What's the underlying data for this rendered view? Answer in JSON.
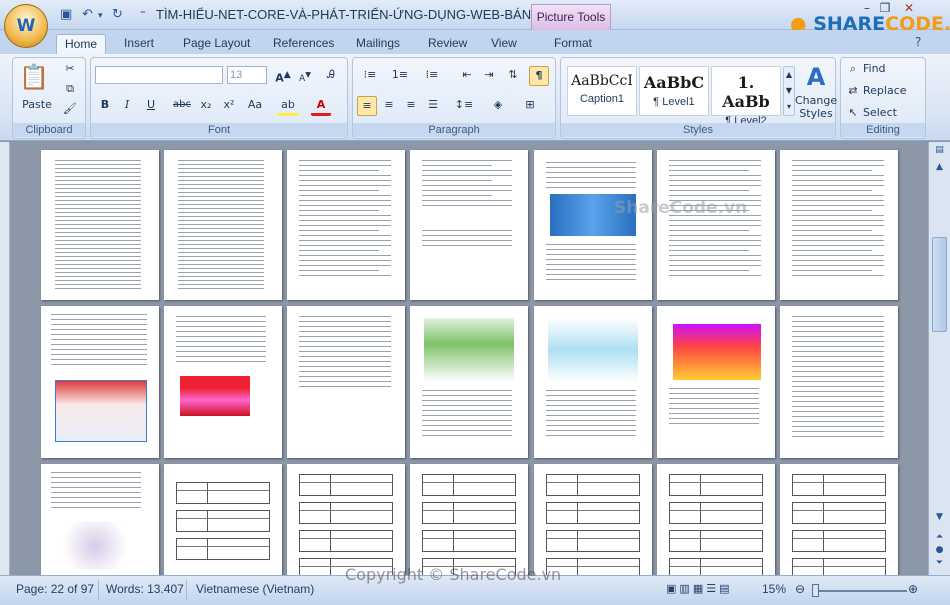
{
  "titlebar": {
    "title": "TÌM-HIỂU-NET-CORE-VÀ-PHÁT-TRIỂN-ỨNG-DỤNG-WEB-BÁN-H...",
    "contextual_tab": "Picture Tools",
    "brand_prefix": "SHARE",
    "brand_suffix": "CODE.vn",
    "office_button_glyph": "W"
  },
  "tabs": [
    {
      "label": "Home",
      "active": true
    },
    {
      "label": "Insert"
    },
    {
      "label": "Page Layout"
    },
    {
      "label": "References"
    },
    {
      "label": "Mailings"
    },
    {
      "label": "Review"
    },
    {
      "label": "View"
    },
    {
      "label": "Format"
    }
  ],
  "ribbon": {
    "clipboard": {
      "label": "Clipboard",
      "paste": "Paste"
    },
    "font": {
      "label": "Font",
      "font_name": "",
      "font_size": "13"
    },
    "paragraph": {
      "label": "Paragraph"
    },
    "styles": {
      "label": "Styles",
      "items": [
        {
          "sample": "AaBbCcI",
          "name": "Caption1"
        },
        {
          "sample": "AaBbC",
          "name": "¶ Level1"
        },
        {
          "sample": "1. AaBb",
          "name": "¶ Level2"
        }
      ],
      "change_styles": "Change Styles"
    },
    "editing": {
      "label": "Editing",
      "find": "Find",
      "replace": "Replace",
      "select": "Select"
    }
  },
  "statusbar": {
    "page": "Page: 22 of 97",
    "words": "Words: 13.407",
    "language": "Vietnamese (Vietnam)",
    "zoom": "15%"
  },
  "watermark": "Copyright © ShareCode.vn",
  "watermark_center": "ShareCode.vn",
  "colors": {
    "accent": "#2a5597",
    "brand": "#1d6fb5",
    "brand_alt": "#f39c1a",
    "workspace": "#8c97a7"
  }
}
